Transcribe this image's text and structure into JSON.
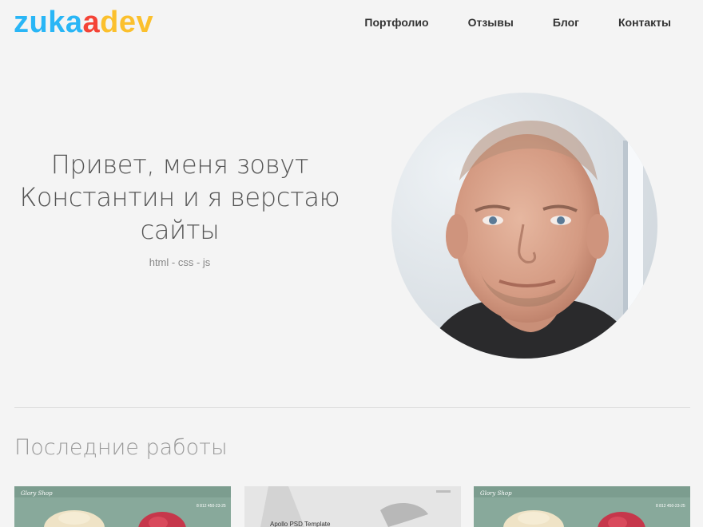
{
  "header": {
    "logo_letters": [
      {
        "char": "z",
        "color": "#29b6f6"
      },
      {
        "char": "u",
        "color": "#29b6f6"
      },
      {
        "char": "k",
        "color": "#29b6f6"
      },
      {
        "char": "a",
        "color": "#29b6f6"
      },
      {
        "char": "a",
        "color": "#f44336"
      },
      {
        "char": "d",
        "color": "#fbc02d"
      },
      {
        "char": "e",
        "color": "#fbc02d"
      },
      {
        "char": "v",
        "color": "#fbc02d"
      }
    ],
    "nav": [
      {
        "label": "Портфолио"
      },
      {
        "label": "Отзывы"
      },
      {
        "label": "Блог"
      },
      {
        "label": "Контакты"
      }
    ]
  },
  "hero": {
    "title": "Привет, меня зовут Константин и я верстаю сайты",
    "subtitle": "html - css - js"
  },
  "section": {
    "title": "Последние работы"
  },
  "works": [
    {
      "label": "Glory Shop",
      "phone": "8 812 450-23-25"
    },
    {
      "label": "Apollo PSD Template"
    },
    {
      "label": "Glory Shop",
      "phone": "8 812 450-23-25"
    }
  ],
  "colors": {
    "background": "#f4f4f4",
    "text": "#555555",
    "muted": "#888888"
  }
}
